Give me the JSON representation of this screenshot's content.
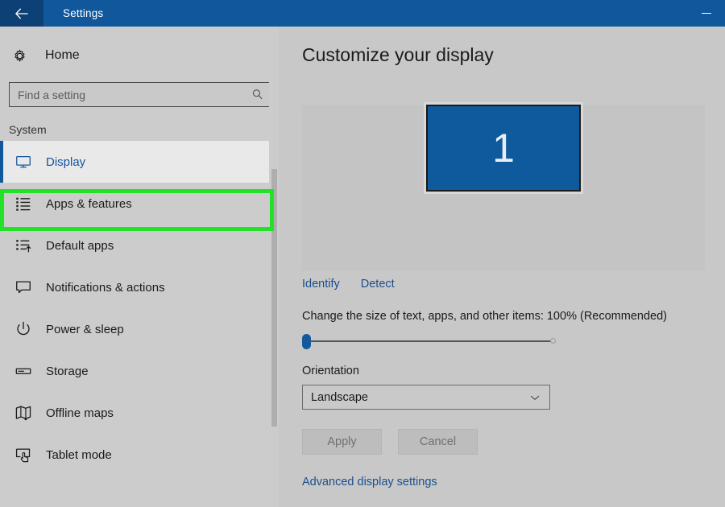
{
  "window": {
    "title": "Settings",
    "back_icon": "back-arrow-icon",
    "minimize_icon": "minimize-icon",
    "titlebar_color": "#10579c",
    "back_zone_color": "#0d4075"
  },
  "sidebar": {
    "home": {
      "label": "Home",
      "icon": "gear-icon"
    },
    "search": {
      "value": "",
      "placeholder": "Find a setting",
      "icon": "search-icon"
    },
    "category": "System",
    "highlight_color": "#22e128",
    "accent_color": "#10579c",
    "items": [
      {
        "label": "Display",
        "icon": "monitor-icon",
        "selected": true
      },
      {
        "label": "Apps & features",
        "icon": "list-icon",
        "selected": false
      },
      {
        "label": "Default apps",
        "icon": "list-arrow-icon",
        "selected": false
      },
      {
        "label": "Notifications & actions",
        "icon": "speech-bubble-icon",
        "selected": false
      },
      {
        "label": "Power & sleep",
        "icon": "power-icon",
        "selected": false
      },
      {
        "label": "Storage",
        "icon": "drive-icon",
        "selected": false
      },
      {
        "label": "Offline maps",
        "icon": "map-icon",
        "selected": false
      },
      {
        "label": "Tablet mode",
        "icon": "tablet-hand-icon",
        "selected": false
      }
    ]
  },
  "main": {
    "page_title": "Customize your display",
    "monitor_preview": {
      "number": "1",
      "color": "#0f5a9c"
    },
    "identify_link": "Identify",
    "detect_link": "Detect",
    "scale_label": "Change the size of text, apps, and other items: 100% (Recommended)",
    "scale_value": "100%",
    "orientation_label": "Orientation",
    "orientation_value": "Landscape",
    "orientation_chevron": "chevron-down-icon",
    "apply_button": "Apply",
    "cancel_button": "Cancel",
    "advanced_link": "Advanced display settings",
    "link_color": "#1b4e8e"
  }
}
